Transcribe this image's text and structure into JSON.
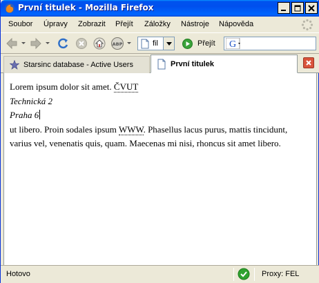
{
  "window": {
    "title": "První titulek - Mozilla Firefox"
  },
  "menu": [
    "Soubor",
    "Úpravy",
    "Zobrazit",
    "Přejít",
    "Záložky",
    "Nástroje",
    "Nápověda"
  ],
  "toolbar": {
    "url_text": "fil",
    "go_label": "Přejít"
  },
  "tabs": [
    {
      "label": "Starsinc database - Active Users",
      "active": false
    },
    {
      "label": "První titulek",
      "active": true
    }
  ],
  "content": {
    "line1_text": "Lorem ipsum dolor sit amet.",
    "abbr1": "ČVUT",
    "address_line1": "Technická 2",
    "address_line2": "Praha 6",
    "para2_prefix": "ut libero. Proin sodales ipsum",
    "abbr2": "WWW",
    "para2_suffix": ". Phasellus lacus purus, mattis tincidunt, varius vel, venenatis quis, quam. Maecenas mi nisi, rhoncus sit amet libero."
  },
  "status": {
    "text": "Hotovo",
    "proxy": "Proxy: FEL"
  },
  "colors": {
    "titlebar": "#0055ea",
    "chrome": "#ece9d8",
    "status_ok": "#2fa22f",
    "tab_close": "#d9533b"
  }
}
